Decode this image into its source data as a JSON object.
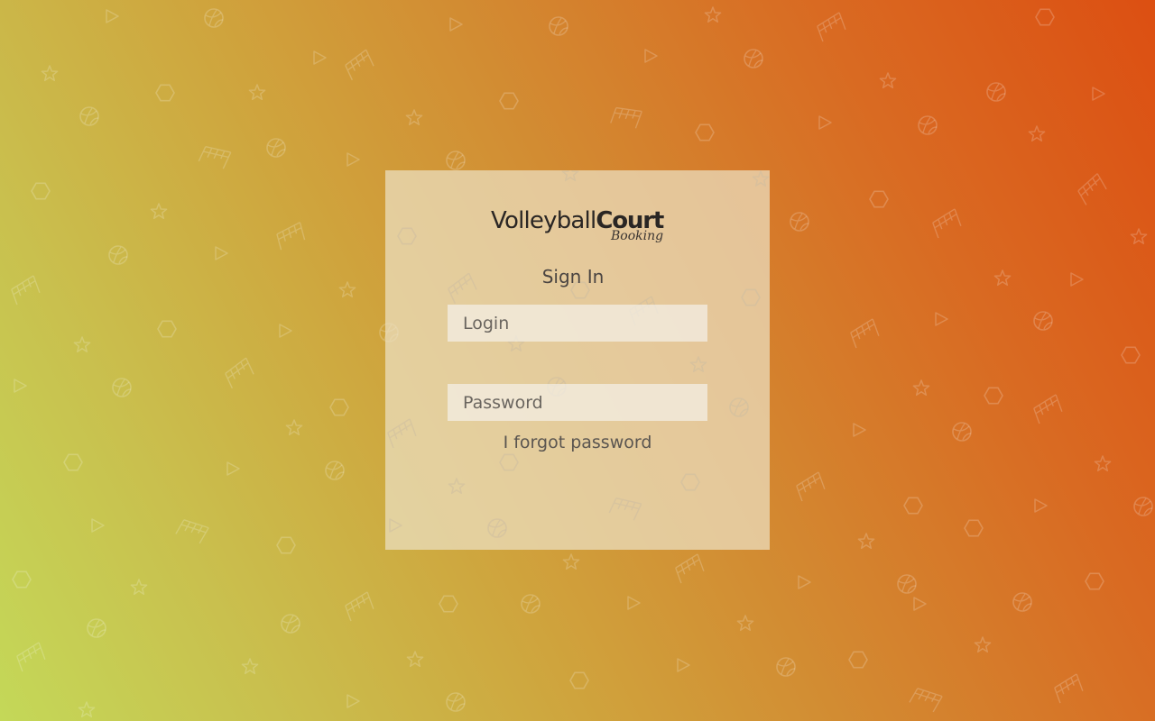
{
  "brand": {
    "name_regular": "Volleyball",
    "name_bold": "Court",
    "subtitle": "Booking"
  },
  "form": {
    "title": "Sign In",
    "login_placeholder": "Login",
    "password_placeholder": "Password",
    "forgot_password_label": "I forgot password"
  },
  "colors": {
    "gradient_start": "#c4d858",
    "gradient_end": "#dc4f12",
    "card_background": "#ece0c4",
    "text_dark": "#2a2624"
  },
  "background_icons": [
    "volleyball-icon",
    "net-icon",
    "hexagon-icon",
    "star-icon",
    "triangle-icon"
  ]
}
